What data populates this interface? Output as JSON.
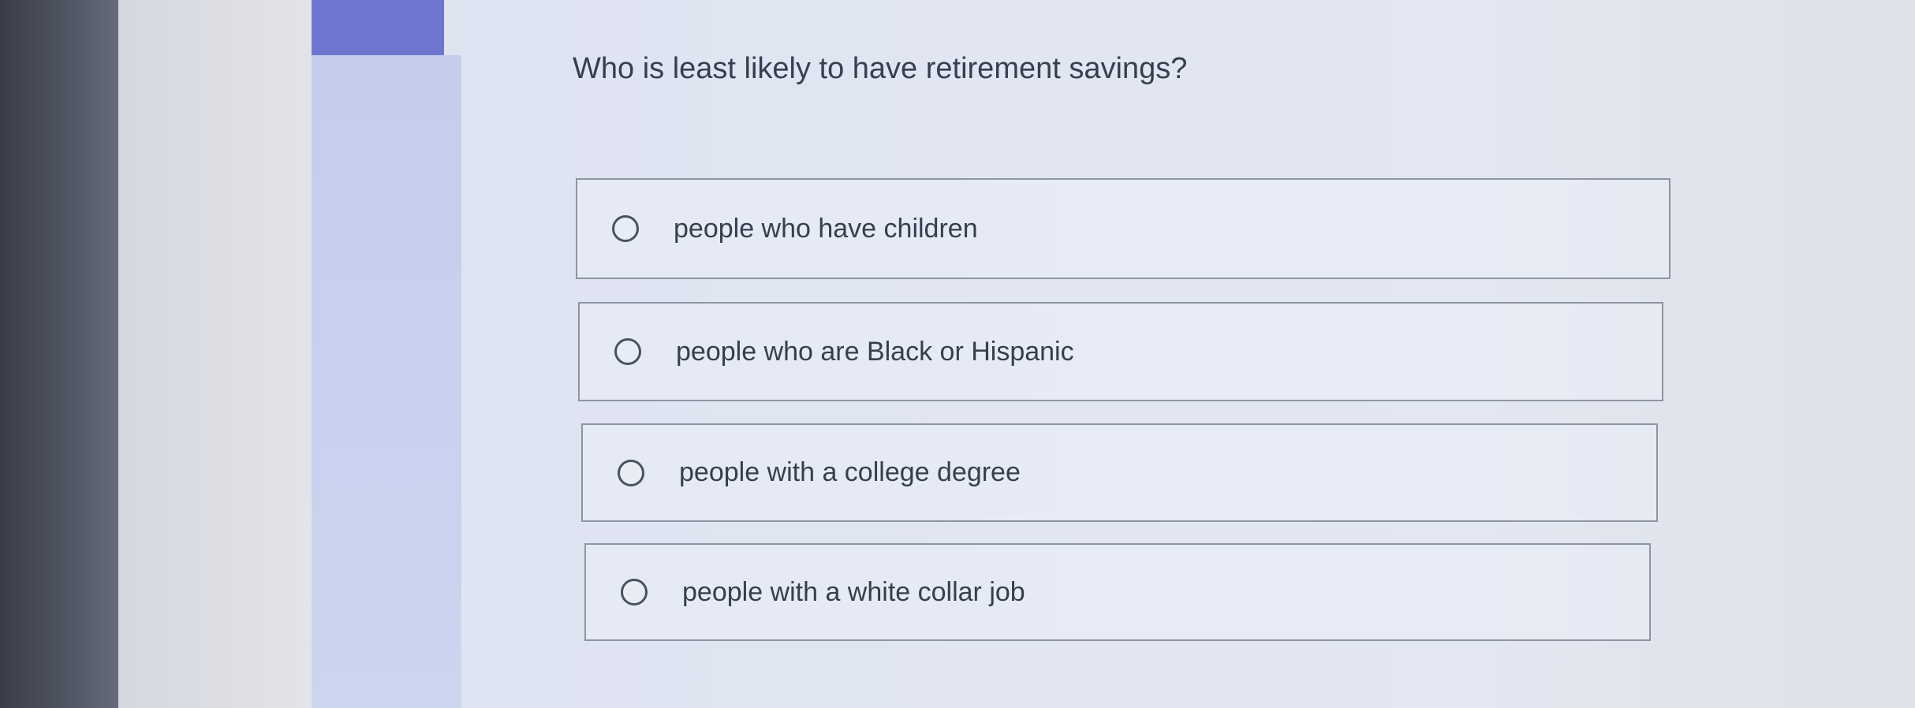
{
  "question": {
    "text": "Who is least likely to have retirement savings?"
  },
  "options": [
    {
      "label": "people who have children",
      "selected": false
    },
    {
      "label": "people who are Black or Hispanic",
      "selected": false
    },
    {
      "label": "people with a college degree",
      "selected": false
    },
    {
      "label": "people with a white collar job",
      "selected": false
    }
  ],
  "colors": {
    "accent_bar": "#6e76cf",
    "side_panel": "#c4cdec",
    "background": "#dfe3ef",
    "text": "#36404f"
  }
}
